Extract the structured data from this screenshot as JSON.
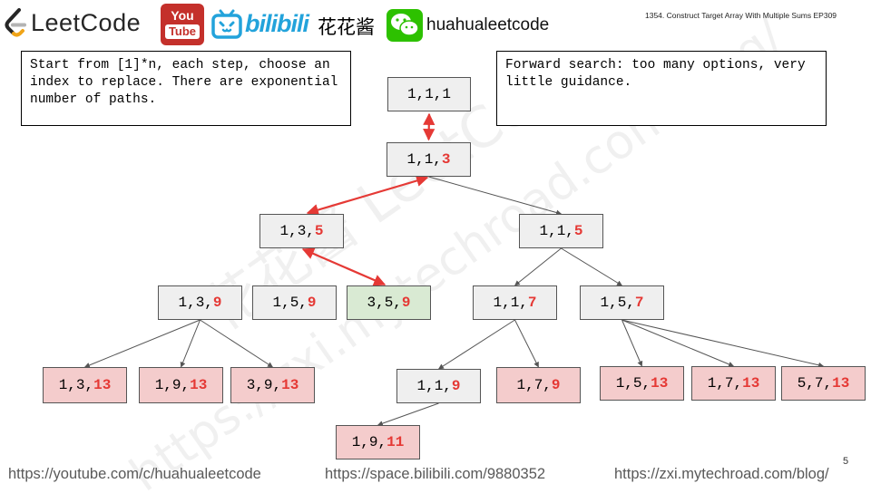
{
  "header": {
    "leetcode_label": "LeetCode",
    "youtube_top": "You",
    "youtube_bottom": "Tube",
    "bilibili_label": "bilibili",
    "bilibili_name": "花花酱",
    "wechat_name": "huahualeetcode",
    "episode_title": "1354. Construct Target Array With Multiple Sums EP309"
  },
  "notes": {
    "left": "Start from [1]*n, each step, choose an index to replace. There are exponential number of paths.",
    "right": "Forward search: too many options, very little guidance."
  },
  "watermark": {
    "line1": "花花酱 LeetCode",
    "line2": "https://zxi.mytechroad.com/blog/"
  },
  "tree": {
    "nodes": [
      {
        "id": "n111",
        "prefix": "1,1,1",
        "hl": "",
        "fill": "gray"
      },
      {
        "id": "n113",
        "prefix": "1,1,",
        "hl": "3",
        "fill": "gray"
      },
      {
        "id": "n135",
        "prefix": "1,3,",
        "hl": "5",
        "fill": "gray"
      },
      {
        "id": "n115",
        "prefix": "1,1,",
        "hl": "5",
        "fill": "gray"
      },
      {
        "id": "n139",
        "prefix": "1,3,",
        "hl": "9",
        "fill": "gray"
      },
      {
        "id": "n159",
        "prefix": "1,5,",
        "hl": "9",
        "fill": "gray"
      },
      {
        "id": "n359",
        "prefix": "3,5,",
        "hl": "9",
        "fill": "green"
      },
      {
        "id": "n117",
        "prefix": "1,1,",
        "hl": "7",
        "fill": "gray"
      },
      {
        "id": "n157",
        "prefix": "1,5,",
        "hl": "7",
        "fill": "gray"
      },
      {
        "id": "n1313",
        "prefix": "1,3,",
        "hl": "13",
        "fill": "pink"
      },
      {
        "id": "n1913",
        "prefix": "1,9,",
        "hl": "13",
        "fill": "pink"
      },
      {
        "id": "n3913",
        "prefix": "3,9,",
        "hl": "13",
        "fill": "pink"
      },
      {
        "id": "n119",
        "prefix": "1,1,",
        "hl": "9",
        "fill": "gray"
      },
      {
        "id": "n179",
        "prefix": "1,7,",
        "hl": "9",
        "fill": "pink"
      },
      {
        "id": "n1513",
        "prefix": "1,5,",
        "hl": "13",
        "fill": "pink"
      },
      {
        "id": "n1713",
        "prefix": "1,7,",
        "hl": "13",
        "fill": "pink"
      },
      {
        "id": "n5713",
        "prefix": "5,7,",
        "hl": "13",
        "fill": "pink"
      },
      {
        "id": "n1911",
        "prefix": "1,9,",
        "hl": "11",
        "fill": "pink"
      }
    ],
    "edges": [
      {
        "from": "n111",
        "to": "n113",
        "style": "red-double"
      },
      {
        "from": "n113",
        "to": "n135",
        "style": "red-double"
      },
      {
        "from": "n113",
        "to": "n115",
        "style": "gray"
      },
      {
        "from": "n135",
        "to": "n359",
        "style": "red-double"
      },
      {
        "from": "n115",
        "to": "n117",
        "style": "gray"
      },
      {
        "from": "n115",
        "to": "n157",
        "style": "gray"
      },
      {
        "from": "n139",
        "to": "n1313",
        "style": "gray"
      },
      {
        "from": "n139",
        "to": "n1913",
        "style": "gray"
      },
      {
        "from": "n139",
        "to": "n3913",
        "style": "gray"
      },
      {
        "from": "n117",
        "to": "n119",
        "style": "gray"
      },
      {
        "from": "n117",
        "to": "n179",
        "style": "gray"
      },
      {
        "from": "n157",
        "to": "n1513",
        "style": "gray"
      },
      {
        "from": "n157",
        "to": "n1713",
        "style": "gray"
      },
      {
        "from": "n157",
        "to": "n5713",
        "style": "gray"
      },
      {
        "from": "n119",
        "to": "n1911",
        "style": "gray"
      }
    ]
  },
  "footer": {
    "youtube_url": "https://youtube.com/c/huahualeetcode",
    "bilibili_url": "https://space.bilibili.com/9880352",
    "blog_url": "https://zxi.mytechroad.com/blog/",
    "page_number": "5"
  },
  "colors": {
    "highlight": "#e53935",
    "red_edge": "#e53935",
    "gray_edge": "#555555",
    "node_gray": "#efefef",
    "node_green": "#d9ead3",
    "node_pink": "#f4cccc"
  }
}
